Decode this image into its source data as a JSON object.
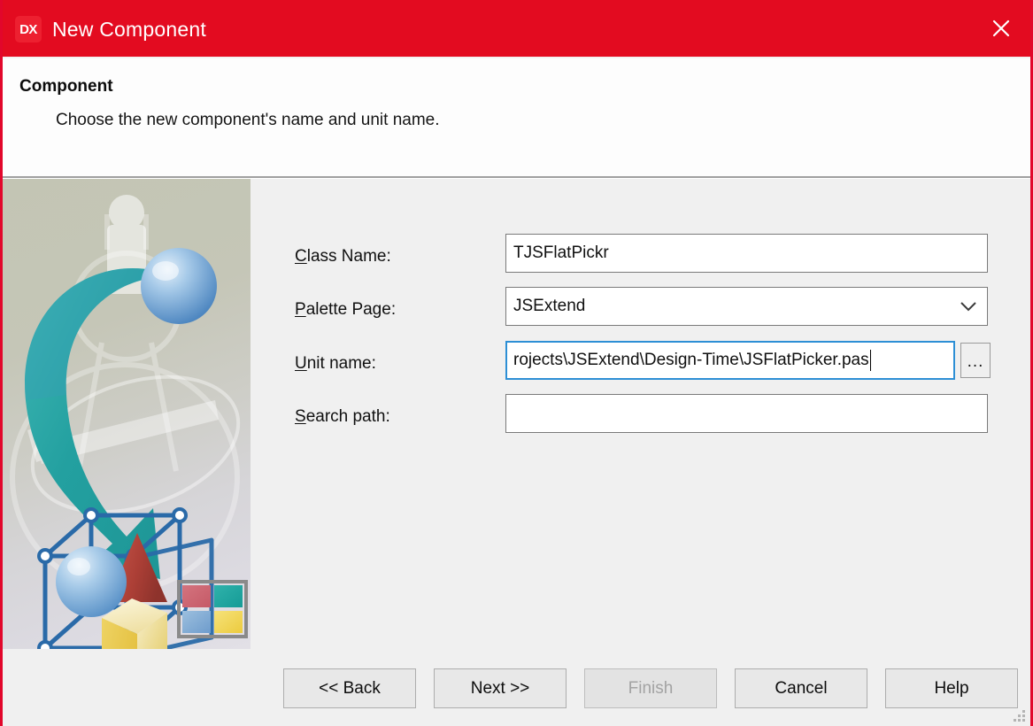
{
  "window": {
    "title": "New Component",
    "logo_text": "DX",
    "logo_icon": "dx-logo-icon",
    "close_icon": "close-icon"
  },
  "header": {
    "title": "Component",
    "description": "Choose the new component's name and unit name."
  },
  "form": {
    "fields": [
      {
        "label_accel": "C",
        "label_rest": "lass Name:",
        "value": "TJSFlatPickr",
        "type": "text",
        "focused": false
      },
      {
        "label_accel": "P",
        "label_rest": "alette Page:",
        "value": "JSExtend",
        "type": "combo",
        "focused": false
      },
      {
        "label_accel": "U",
        "label_rest": "nit name:",
        "value": "rojects\\JSExtend\\Design-Time\\JSFlatPicker.pas",
        "type": "text-browse",
        "focused": true,
        "browse_label": "..."
      },
      {
        "label_accel": "S",
        "label_rest": "earch path:",
        "value": "",
        "type": "text",
        "focused": false
      }
    ]
  },
  "footer": {
    "buttons": [
      {
        "label": "<< Back",
        "disabled": false
      },
      {
        "label": "Next >>",
        "disabled": false
      },
      {
        "label": "Finish",
        "disabled": true
      },
      {
        "label": "Cancel",
        "disabled": false
      },
      {
        "label": "Help",
        "disabled": false
      }
    ]
  },
  "illustration": {
    "name": "new-component-wizard-illustration",
    "colors": {
      "arrow_teal": "#2aa3a3",
      "sphere_blue": "#6ba3d6",
      "cube_wire_blue": "#2a6aa8",
      "cube_yellow": "#e8c84a",
      "cone_red": "#b2453c",
      "logo_rose": "#cc6572",
      "logo_teal": "#1fa9a2",
      "logo_blue": "#7ca8d4",
      "logo_yellow": "#f0d24f"
    }
  },
  "theme": {
    "accent_red": "#e30b20",
    "body_bg": "#f0f0f0",
    "header_bg": "#fdfdfd",
    "focus_blue": "#2d8fd5"
  }
}
